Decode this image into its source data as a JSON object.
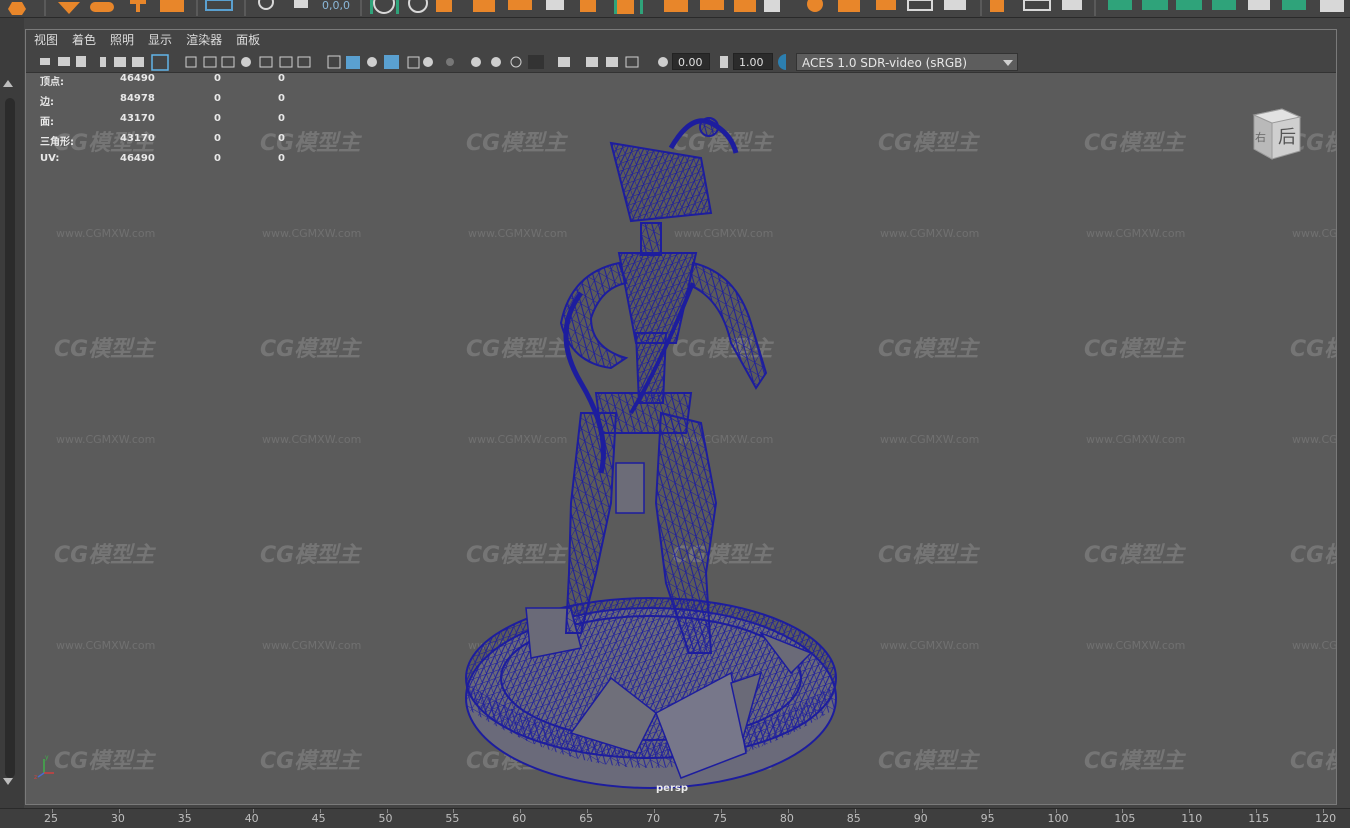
{
  "shelf": {
    "coord_readout": "0,0,0",
    "accent_color": "#e8862a",
    "green_color": "#2fa37a"
  },
  "menubar": {
    "items": [
      "视图",
      "着色",
      "照明",
      "显示",
      "渲染器",
      "面板"
    ]
  },
  "toolbar": {
    "exposure_value": "0.00",
    "gamma_value": "1.00",
    "color_space": "ACES 1.0 SDR-video (sRGB)"
  },
  "hud": {
    "rows": [
      {
        "label": "顶点:",
        "v1": "46490",
        "v2": "0",
        "v3": "0"
      },
      {
        "label": "边:",
        "v1": "84978",
        "v2": "0",
        "v3": "0"
      },
      {
        "label": "面:",
        "v1": "43170",
        "v2": "0",
        "v3": "0"
      },
      {
        "label": "三角形:",
        "v1": "43170",
        "v2": "0",
        "v3": "0"
      },
      {
        "label": "UV:",
        "v1": "46490",
        "v2": "0",
        "v3": "0"
      }
    ]
  },
  "viewcube": {
    "face_label": "后",
    "side_label": "右"
  },
  "viewport": {
    "camera_name": "persp",
    "watermark_logo": "CG模型主",
    "watermark_url": "www.CGMXW.com",
    "wireframe_color": "#1a1a9a"
  },
  "timeline": {
    "ticks": [
      "25",
      "30",
      "35",
      "40",
      "45",
      "50",
      "55",
      "60",
      "65",
      "70",
      "75",
      "80",
      "85",
      "90",
      "95",
      "100",
      "105",
      "110",
      "115",
      "120"
    ]
  }
}
